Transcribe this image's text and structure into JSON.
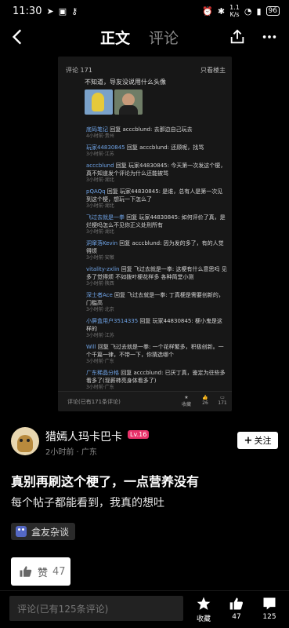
{
  "status": {
    "time": "11:30",
    "net_speed": "1.1\nK/s",
    "battery": "96"
  },
  "nav": {
    "tab_main": "正文",
    "tab_comments": "评论"
  },
  "shot": {
    "header_left": "评论 171",
    "header_right": "只看楼主",
    "main_text": "不知道，导友没说用什么头像",
    "replies": [
      {
        "user": "底码笔记",
        "text": " 回复 acccblund: 去那边自己玩去",
        "meta": "4小时前·贵州"
      },
      {
        "user": "玩家44830845",
        "text": " 回复 acccblund: 还顾呢，找骂",
        "meta": "3小时前·江苏"
      },
      {
        "user": "acccblund",
        "text": " 回复 玩家44830845: 今天第一次发这个梗，真不知道发个评论为什么还能被骂",
        "meta": "3小时前·湖北"
      },
      {
        "user": "pQAQq",
        "text": " 回复 玩家44830845: 是谁，总有人是第一次见到这个梗，想玩一下怎么了",
        "meta": "3小时前·湖北"
      },
      {
        "user": "飞过去就是一拳",
        "text": " 回复 玩家44830845: 如何评价了真，是烂梗吗怎么不见你正义处刑所有",
        "meta": "3小时前·湖北"
      },
      {
        "user": "洞窜落Kevin",
        "text": " 回复 acccblund: 因为发的多了，有的人觉得烦",
        "meta": "3小时前·安徽"
      },
      {
        "user": "vitality-zxlin",
        "text": " 回复 飞过去就是一拳: 这梗有什么意思吗 见多了觉得烦 不如拨叶梗花样多 各种简堂小测",
        "meta": "3小时前·陕西"
      },
      {
        "user": "深士者Ace",
        "text": " 回复 飞过去就是一拳: 丁真梗是需要创新的，门槛高",
        "meta": "3小时前·北京"
      },
      {
        "user": "小屏盒用户3514335",
        "text": " 回复 玩家44830845: 梗小鬼是这样的",
        "meta": "3小时前·江苏"
      },
      {
        "user": "Will",
        "text": " 回复 飞过去就是一拳: 一个花样繁多，积极创新。一个千篇一律，不带一下，你猜选哪个",
        "meta": "3小时前·广东"
      },
      {
        "user": "广东稀晶分格",
        "text": " 回复 acccblund: 已厌丁真，鉴定为往些多看多了(现薪柿亮身体看多了)",
        "meta": "3小时前·广东"
      }
    ],
    "footer_input": "评论(已有171条评论)",
    "footer_fav": "收藏",
    "footer_like": "26",
    "footer_comment": "171"
  },
  "author": {
    "name": "猎嫣人玛卡巴卡",
    "level": "Lv.16",
    "meta": "2小时前 · 广东",
    "follow": "关注"
  },
  "post": {
    "title": "真别再刷这个梗了，一点营养没有",
    "body": "每个帖子都能看到，我真的想吐",
    "circle": "盒友杂谈"
  },
  "like": {
    "label": "赞",
    "count": "47"
  },
  "bottom": {
    "comment_placeholder": "评论(已有125条评论)",
    "fav": "收藏",
    "like_count": "47",
    "comment_count": "125"
  }
}
